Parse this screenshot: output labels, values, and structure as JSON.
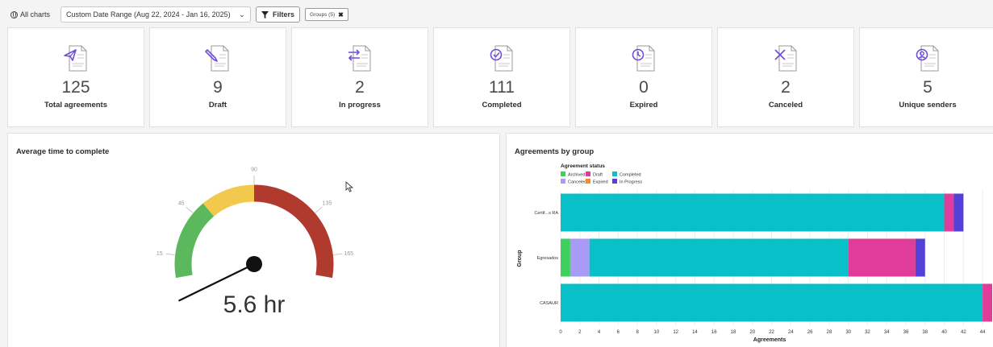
{
  "toolbar": {
    "all_charts": "All charts",
    "date_range": "Custom Date Range (Aug 22, 2024 - Jan 16, 2025)",
    "filters": "Filters",
    "chip": "Groups (5)"
  },
  "kpis": [
    {
      "value": "125",
      "label": "Total agreements",
      "icon": "send-icon"
    },
    {
      "value": "9",
      "label": "Draft",
      "icon": "pencil-icon"
    },
    {
      "value": "2",
      "label": "In progress",
      "icon": "arrows-exchange-icon"
    },
    {
      "value": "111",
      "label": "Completed",
      "icon": "check-circle-icon"
    },
    {
      "value": "0",
      "label": "Expired",
      "icon": "clock-icon"
    },
    {
      "value": "2",
      "label": "Canceled",
      "icon": "x-icon"
    },
    {
      "value": "5",
      "label": "Unique senders",
      "icon": "user-circle-icon"
    }
  ],
  "colors": {
    "accent": "#6e4fd6",
    "gauge_green": "#5cb85c",
    "gauge_yellow": "#f2c94c",
    "gauge_red": "#b03a2e"
  },
  "gauge": {
    "title": "Average time to complete",
    "value_text": "5.6 hr",
    "ticks": [
      "15",
      "45",
      "90",
      "135",
      "165"
    ]
  },
  "chart_data": {
    "type": "bar",
    "title": "Agreements by group",
    "legend_title": "Agreement status",
    "xlabel": "Agreements",
    "ylabel": "Group",
    "xlim": [
      0,
      45
    ],
    "xticks": [
      0,
      2,
      4,
      6,
      8,
      10,
      12,
      14,
      16,
      18,
      20,
      22,
      24,
      26,
      28,
      30,
      32,
      34,
      36,
      38,
      40,
      42,
      44
    ],
    "categories": [
      "Certif...s RA",
      "Egresados",
      "CASAUR"
    ],
    "series": [
      {
        "name": "Archived",
        "color": "#3ecf5c",
        "values": [
          0,
          1,
          0
        ]
      },
      {
        "name": "Canceled",
        "color": "#a89bf5",
        "values": [
          0,
          2,
          0
        ]
      },
      {
        "name": "Completed",
        "color": "#0ac0c8",
        "values": [
          40,
          27,
          44
        ]
      },
      {
        "name": "Draft",
        "color": "#e03d9a",
        "values": [
          1,
          7,
          1
        ]
      },
      {
        "name": "Expired",
        "color": "#f28b30",
        "values": [
          0,
          0,
          0
        ]
      },
      {
        "name": "In Progress",
        "color": "#5340d6",
        "values": [
          1,
          1,
          0
        ]
      }
    ],
    "legend_order": [
      "Archived",
      "Draft",
      "Completed",
      "Canceled",
      "Expired",
      "In Progress"
    ],
    "grid": true,
    "legend_position": "top-left"
  }
}
